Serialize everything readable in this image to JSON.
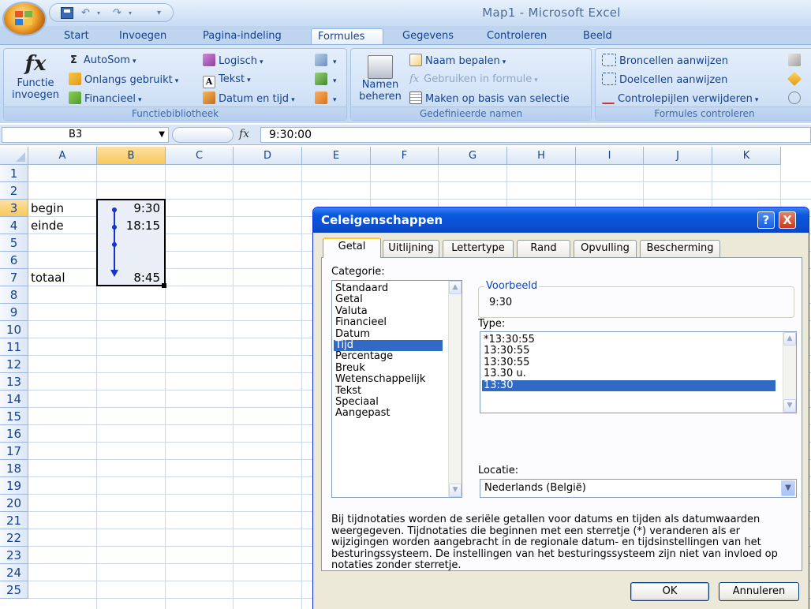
{
  "window": {
    "title": "Map1 - Microsoft Excel"
  },
  "ribbon_tabs": [
    "Start",
    "Invoegen",
    "Pagina-indeling",
    "Formules",
    "Gegevens",
    "Controleren",
    "Beeld"
  ],
  "ribbon": {
    "insert_function": {
      "line1": "Functie",
      "line2": "invoegen"
    },
    "library": {
      "autosum": "AutoSom",
      "recent": "Onlangs gebruikt",
      "financial": "Financieel",
      "logical": "Logisch",
      "text": "Tekst",
      "datetime": "Datum en tijd",
      "title": "Functiebibliotheek"
    },
    "names": {
      "manager_line1": "Namen",
      "manager_line2": "beheren",
      "define": "Naam bepalen",
      "use_in_formula": "Gebruiken in formule",
      "create_from_selection": "Maken op basis van selectie",
      "title": "Gedefinieerde namen"
    },
    "audit": {
      "precedents": "Broncellen aanwijzen",
      "dependents": "Doelcellen aanwijzen",
      "remove_arrows": "Controlepijlen verwijderen",
      "title": "Formules controleren"
    }
  },
  "formula_bar": {
    "namebox": "B3",
    "fx": "fx",
    "formula": "9:30:00"
  },
  "columns": [
    "A",
    "B",
    "C",
    "D",
    "E",
    "F",
    "G",
    "H",
    "I",
    "J",
    "K"
  ],
  "rows": [
    "1",
    "2",
    "3",
    "4",
    "5",
    "6",
    "7",
    "8",
    "9",
    "10",
    "11",
    "12",
    "13",
    "14",
    "15",
    "16",
    "17",
    "18",
    "19",
    "20",
    "21",
    "22",
    "23",
    "24",
    "25"
  ],
  "cells": {
    "A3": "begin",
    "B3": "9:30",
    "A4": "einde",
    "B4": "18:15",
    "A7": "totaal",
    "B7": "8:45"
  },
  "dialog": {
    "title": "Celeigenschappen",
    "help": "?",
    "close": "X",
    "tabs": [
      "Getal",
      "Uitlijning",
      "Lettertype",
      "Rand",
      "Opvulling",
      "Bescherming"
    ],
    "category_label": "Categorie:",
    "categories": [
      "Standaard",
      "Getal",
      "Valuta",
      "Financieel",
      "Datum",
      "Tijd",
      "Percentage",
      "Breuk",
      "Wetenschappelijk",
      "Tekst",
      "Speciaal",
      "Aangepast"
    ],
    "selected_category": "Tijd",
    "sample_label": "Voorbeeld",
    "sample_value": "9:30",
    "type_label": "Type:",
    "types": [
      "*13:30:55",
      "13:30:55",
      "13:30:55",
      "13.30 u.",
      "13:30"
    ],
    "selected_type": "13:30",
    "locale_label": "Locatie:",
    "locale_value": "Nederlands (België)",
    "description": "Bij tijdnotaties worden de seriële getallen voor datums en tijden als datumwaarden weergegeven. Tijdnotaties die beginnen met een sterretje (*) veranderen als er wijzigingen worden aangebracht in de regionale datum- en tijdsinstellingen van het besturingssysteem. De instellingen van het besturingssysteem zijn niet van invloed op notaties zonder sterretje.",
    "ok": "OK",
    "cancel": "Annuleren"
  },
  "colors": {
    "accent": "#316ac5",
    "trace_arrow": "#1432d4",
    "dialog_title": "#0a58df"
  }
}
